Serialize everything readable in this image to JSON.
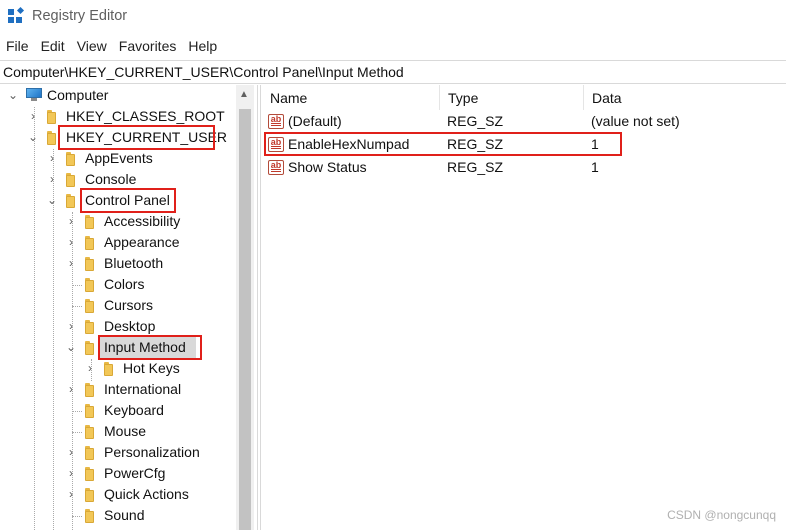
{
  "window": {
    "title": "Registry Editor",
    "accent": "#1f6fc1"
  },
  "menu": [
    "File",
    "Edit",
    "View",
    "Favorites",
    "Help"
  ],
  "address": "Computer\\HKEY_CURRENT_USER\\Control Panel\\Input Method",
  "tree": {
    "root": "Computer",
    "items": [
      {
        "label": "HKEY_CLASSES_ROOT",
        "expanded": false
      },
      {
        "label": "HKEY_CURRENT_USER",
        "expanded": true,
        "highlighted": true
      },
      {
        "label": "AppEvents",
        "expanded": false
      },
      {
        "label": "Console",
        "expanded": false
      },
      {
        "label": "Control Panel",
        "expanded": true,
        "highlighted": true
      },
      {
        "label": "Accessibility",
        "expanded": false
      },
      {
        "label": "Appearance",
        "expanded": false
      },
      {
        "label": "Bluetooth",
        "expanded": false
      },
      {
        "label": "Colors",
        "expanded": null
      },
      {
        "label": "Cursors",
        "expanded": null
      },
      {
        "label": "Desktop",
        "expanded": false
      },
      {
        "label": "Input Method",
        "expanded": true,
        "selected": true,
        "highlighted": true
      },
      {
        "label": "Hot Keys",
        "expanded": false
      },
      {
        "label": "International",
        "expanded": false
      },
      {
        "label": "Keyboard",
        "expanded": null
      },
      {
        "label": "Mouse",
        "expanded": null
      },
      {
        "label": "Personalization",
        "expanded": false
      },
      {
        "label": "PowerCfg",
        "expanded": false
      },
      {
        "label": "Quick Actions",
        "expanded": false
      },
      {
        "label": "Sound",
        "expanded": null
      }
    ]
  },
  "list": {
    "columns": [
      "Name",
      "Type",
      "Data"
    ],
    "rows": [
      {
        "name": "(Default)",
        "type": "REG_SZ",
        "data": "(value not set)",
        "icon": "string-value-icon"
      },
      {
        "name": "EnableHexNumpad",
        "type": "REG_SZ",
        "data": "1",
        "icon": "string-value-icon",
        "highlighted": true
      },
      {
        "name": "Show Status",
        "type": "REG_SZ",
        "data": "1",
        "icon": "string-value-icon"
      }
    ]
  },
  "watermark": "CSDN @nongcunqq",
  "highlight_color": "#e0201a"
}
